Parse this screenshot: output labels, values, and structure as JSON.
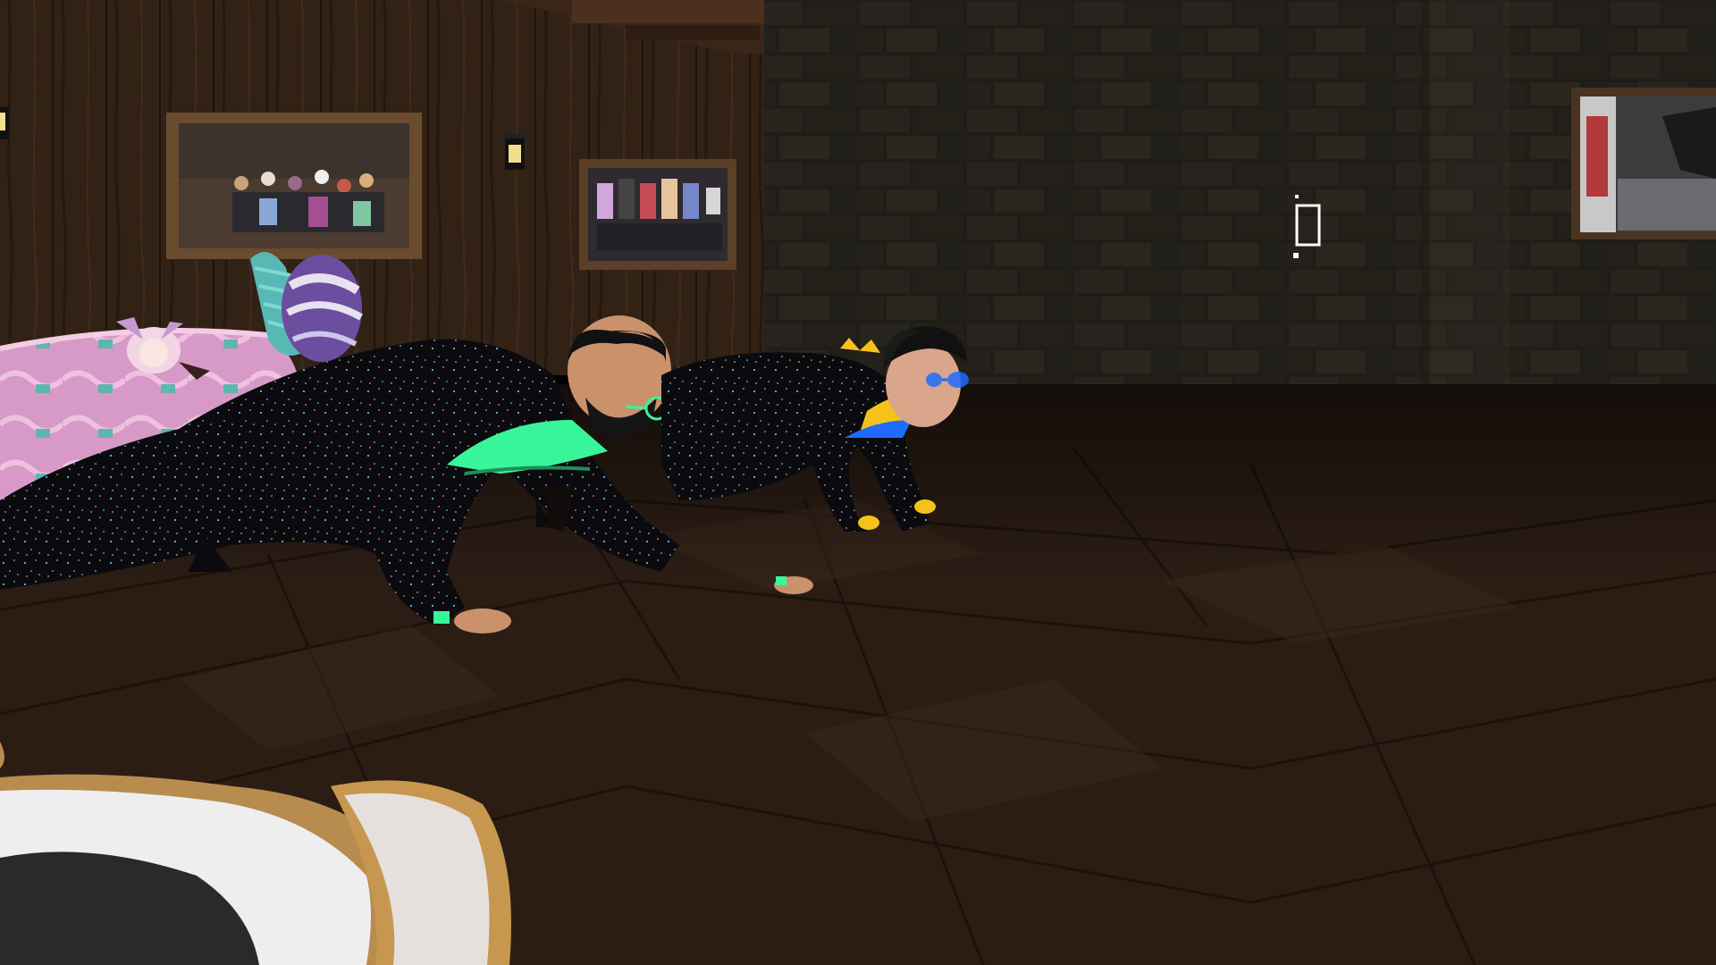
{
  "scene": {
    "setting": "vr-social-world-room",
    "colors": {
      "wood_wall": "#3a2719",
      "stone_wall": "#2f2b22",
      "floor": "#2b1d14",
      "bed_pink": "#d59ac6",
      "avatar_suit": "#0b0b0f",
      "accent_green": "#39f59a",
      "accent_blue": "#1d6cff",
      "accent_yellow": "#f5c21b"
    },
    "icons": {
      "cursor": "phone-outline-icon",
      "lantern": "lantern-icon"
    }
  }
}
